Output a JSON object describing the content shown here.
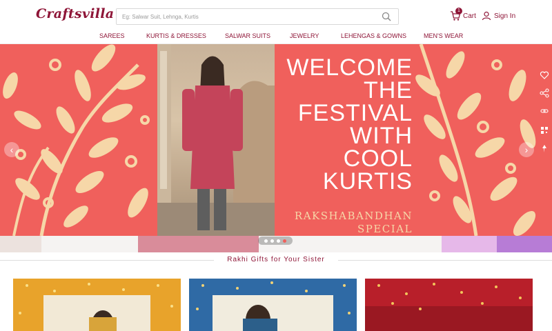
{
  "brand": {
    "logo_text": "Craftsvilla",
    "accent": "#8e1537"
  },
  "search": {
    "placeholder": "Eg: Salwar Suit, Lehnga, Kurtis",
    "icon": "search-icon"
  },
  "header": {
    "cart_label": "Cart",
    "cart_count": "1",
    "signin_label": "Sign In"
  },
  "nav": {
    "items": [
      "SAREES",
      "KURTIS & DRESSES",
      "SALWAR SUITS",
      "JEWELRY",
      "LEHENGAS & GOWNS",
      "MEN'S WEAR"
    ]
  },
  "banner": {
    "headline": [
      "WELCOME",
      "THE",
      "FESTIVAL",
      "WITH",
      "COOL",
      "KURTIS"
    ],
    "subline": [
      "RAKSHABANDHAN",
      "SPECIAL"
    ],
    "bg_color": "#f0605c",
    "leaf_color": "#f6d7a8",
    "slide_count": 4,
    "active_slide": 4
  },
  "section": {
    "title": "Rakhi Gifts for Your Sister"
  },
  "cards": [
    {
      "bg": "#e8a32b"
    },
    {
      "bg": "#2f6aa5"
    },
    {
      "bg": "#b81f2a"
    }
  ]
}
